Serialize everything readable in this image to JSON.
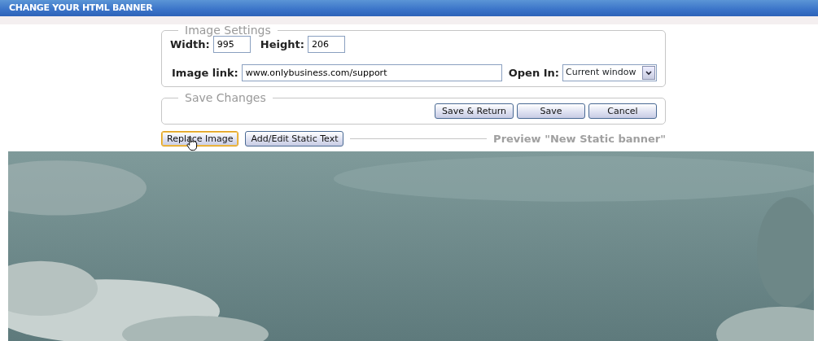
{
  "window": {
    "title": "CHANGE YOUR HTML BANNER"
  },
  "image_settings": {
    "legend": "Image Settings",
    "width_label": "Width:",
    "width_value": "995",
    "height_label": "Height:",
    "height_value": "206",
    "link_label": "Image link:",
    "link_value": "www.onlybusiness.com/support",
    "open_in_label": "Open In:",
    "open_in_value": "Current window"
  },
  "save_changes": {
    "legend": "Save Changes",
    "buttons": [
      {
        "label": "Save & Return"
      },
      {
        "label": "Save"
      },
      {
        "label": "Cancel"
      }
    ]
  },
  "toolbar": {
    "buttons": [
      {
        "label": "Replace Image",
        "hovered": true
      },
      {
        "label": "Add/Edit Static Text",
        "hovered": false
      }
    ],
    "preview_title": "Preview \"New Static banner\""
  }
}
